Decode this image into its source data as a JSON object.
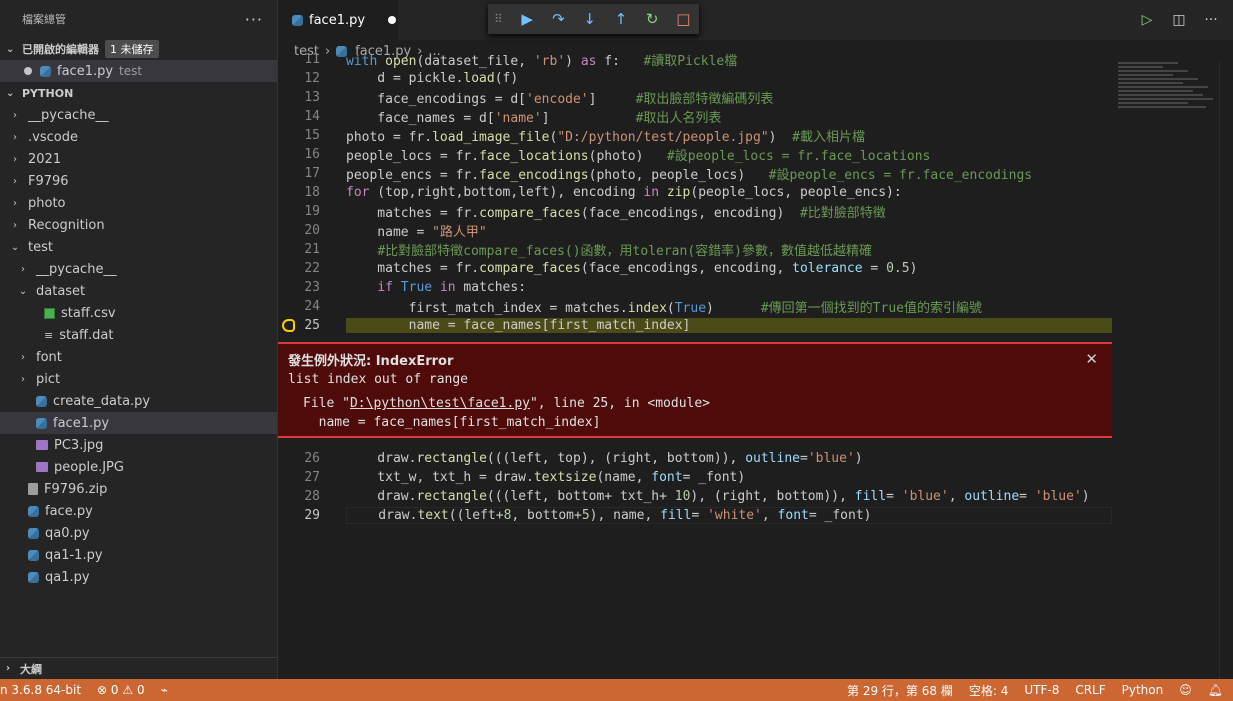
{
  "sidebar": {
    "title": "檔案總管",
    "open_editors": {
      "label": "已開啟的編輯器",
      "badge": "1 未儲存",
      "item": {
        "name": "face1.py",
        "desc": "test"
      }
    },
    "project": "PYTHON",
    "items": [
      {
        "label": "__pycache__",
        "type": "folder",
        "indent": 1,
        "open": false
      },
      {
        "label": ".vscode",
        "type": "folder",
        "indent": 1,
        "open": false
      },
      {
        "label": "2021",
        "type": "folder",
        "indent": 1,
        "open": false
      },
      {
        "label": "F9796",
        "type": "folder",
        "indent": 1,
        "open": false
      },
      {
        "label": "photo",
        "type": "folder",
        "indent": 1,
        "open": false
      },
      {
        "label": "Recognition",
        "type": "folder",
        "indent": 1,
        "open": false
      },
      {
        "label": "test",
        "type": "folder",
        "indent": 1,
        "open": true
      },
      {
        "label": "__pycache__",
        "type": "folder",
        "indent": 2,
        "open": false
      },
      {
        "label": "dataset",
        "type": "folder",
        "indent": 2,
        "open": true
      },
      {
        "label": "staff.csv",
        "type": "csv",
        "indent": 3
      },
      {
        "label": "staff.dat",
        "type": "dat",
        "indent": 3
      },
      {
        "label": "font",
        "type": "folder",
        "indent": 2,
        "open": false
      },
      {
        "label": "pict",
        "type": "folder",
        "indent": 2,
        "open": false
      },
      {
        "label": "create_data.py",
        "type": "py",
        "indent": 2
      },
      {
        "label": "face1.py",
        "type": "py",
        "indent": 2,
        "selected": true
      },
      {
        "label": "PC3.jpg",
        "type": "jpg",
        "indent": 2
      },
      {
        "label": "people.JPG",
        "type": "jpg",
        "indent": 2
      },
      {
        "label": "F9796.zip",
        "type": "zip",
        "indent": 1
      },
      {
        "label": "face.py",
        "type": "py",
        "indent": 1
      },
      {
        "label": "qa0.py",
        "type": "py",
        "indent": 1
      },
      {
        "label": "qa1-1.py",
        "type": "py",
        "indent": 1
      },
      {
        "label": "qa1.py",
        "type": "py",
        "indent": 1
      }
    ],
    "outline": "大綱"
  },
  "editor": {
    "tab": "face1.py",
    "breadcrumb": {
      "folder": "test",
      "file": "face1.py",
      "rest": "..."
    },
    "exception": {
      "title": "發生例外狀況: IndexError",
      "message": "list index out of range",
      "trace_prefix": "File \"",
      "trace_file": "D:\\python\\test\\face1.py",
      "trace_suffix": "\", line 25, in <module>",
      "trace_code": "  name = face_names[first_match_index]"
    }
  },
  "statusbar": {
    "interpreter": "n 3.6.8 64-bit",
    "errors": "0",
    "warnings": "0",
    "position": "第 29 行，第 68 欄",
    "spaces": "空格: 4",
    "encoding": "UTF-8",
    "eol": "CRLF",
    "language": "Python"
  },
  "colors": {
    "statusbar": "#cc6633",
    "exception_bg": "#4f0a0a",
    "current_line": "#4b4b18"
  }
}
